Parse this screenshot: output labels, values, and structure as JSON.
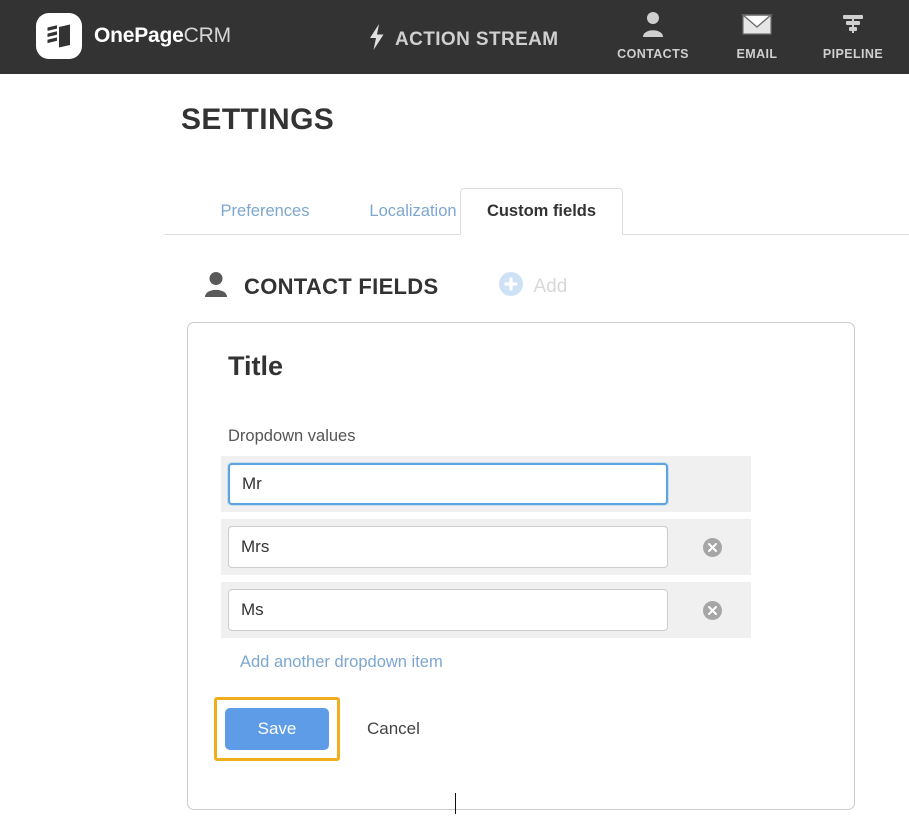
{
  "topbar": {
    "brand": {
      "bold": "OnePage",
      "light": "CRM",
      "logo_icon": "book-logo-icon"
    },
    "action_stream": {
      "label": "ACTION STREAM",
      "icon": "lightning-bolt-icon"
    },
    "nav": [
      {
        "label": "CONTACTS",
        "icon": "person-icon"
      },
      {
        "label": "EMAIL",
        "icon": "envelope-icon"
      },
      {
        "label": "PIPELINE",
        "icon": "funnel-icon"
      }
    ]
  },
  "page": {
    "title": "SETTINGS"
  },
  "tabs": [
    {
      "label": "Preferences",
      "active": false
    },
    {
      "label": "Localization",
      "active": false
    },
    {
      "label": "Custom fields",
      "active": true
    }
  ],
  "section": {
    "icon": "person-icon",
    "title": "CONTACT FIELDS",
    "add_label": "Add",
    "add_icon": "plus-circle-icon"
  },
  "card": {
    "field_title": "Title",
    "dropdown_label": "Dropdown values",
    "rows": [
      {
        "value": "Mr",
        "focused": true,
        "deletable": false
      },
      {
        "value": "Mrs",
        "focused": false,
        "deletable": true
      },
      {
        "value": "Ms",
        "focused": false,
        "deletable": true
      }
    ],
    "add_another_label": "Add another dropdown item",
    "save_label": "Save",
    "cancel_label": "Cancel"
  },
  "colors": {
    "topbar_bg": "#333333",
    "link_blue": "#7da7d0",
    "save_blue": "#5f9ce8",
    "highlight_amber": "#f0ad1e",
    "focus_blue": "#5ba4e5",
    "row_bg": "#f0f0f0"
  }
}
